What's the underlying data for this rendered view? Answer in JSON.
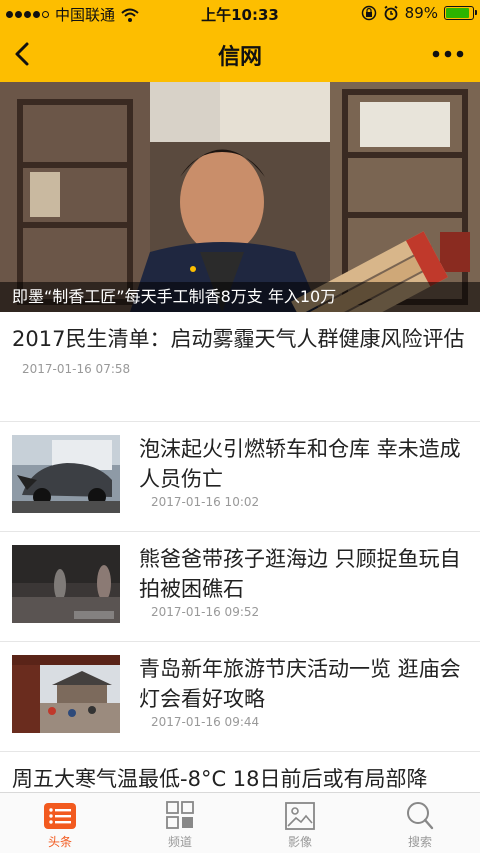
{
  "status_bar": {
    "carrier": "中国联通",
    "time": "上午10:33",
    "battery_text": "89%",
    "battery_level": 0.89,
    "icons": [
      "signal-dots-icon",
      "wifi-icon",
      "rotation-lock-icon",
      "alarm-icon",
      "battery-icon"
    ]
  },
  "header": {
    "title": "信网",
    "back_icon": "chevron-left-icon",
    "more_icon": "more-dots-icon",
    "color": "#fdbe00"
  },
  "hero": {
    "caption": "即墨“制香工匠”每天手工制香8万支 年入10万"
  },
  "feed": {
    "featured": {
      "headline": "2017民生清单：启动雾霾天气人群健康风险评估",
      "date": "2017-01-16 07:58"
    },
    "items": [
      {
        "headline": "泡沫起火引燃轿车和仓库 幸未造成人员伤亡",
        "date": "2017-01-16 10:02"
      },
      {
        "headline": "熊爸爸带孩子逛海边 只顾捉鱼玩自拍被困礁石",
        "date": "2017-01-16 09:52"
      },
      {
        "headline": "青岛新年旅游节庆活动一览 逛庙会灯会看好攻略",
        "date": "2017-01-16 09:44"
      }
    ],
    "partial": {
      "headline": "周五大寒气温最低-8°C 18日前后或有局部降"
    }
  },
  "tabs": [
    {
      "label": "头条",
      "icon": "headlines-list-icon",
      "active": true
    },
    {
      "label": "频道",
      "icon": "channels-grid-icon",
      "active": false
    },
    {
      "label": "影像",
      "icon": "image-icon",
      "active": false
    },
    {
      "label": "搜索",
      "icon": "search-icon",
      "active": false
    }
  ],
  "colors": {
    "accent": "#f25a1f",
    "header": "#fdbe00",
    "tab_inactive": "#999999"
  }
}
